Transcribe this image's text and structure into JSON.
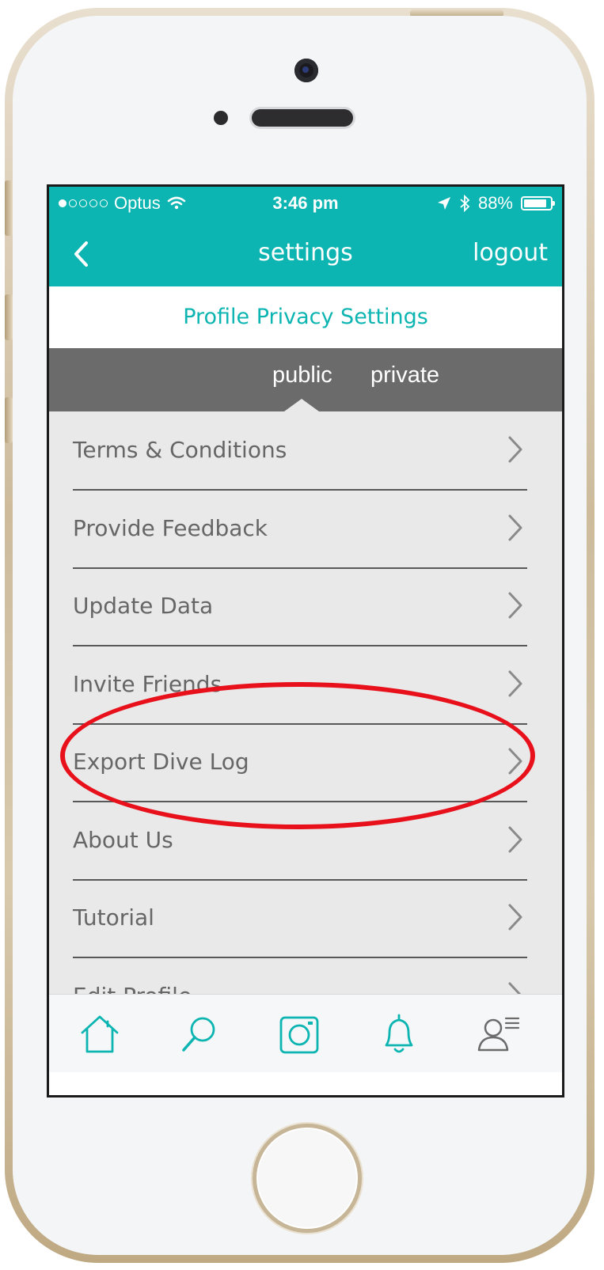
{
  "status_bar": {
    "carrier": "Optus",
    "time": "3:46 pm",
    "battery": "88%",
    "battery_level": 0.88,
    "signal_bars_filled": 1,
    "signal_bars_total": 5
  },
  "nav": {
    "back_icon": "chevron-left-icon",
    "title": "settings",
    "logout_label": "logout"
  },
  "privacy_link": "Profile Privacy Settings",
  "privacy_toggle": {
    "public_label": "public",
    "private_label": "private",
    "selected": "public"
  },
  "settings_items": [
    {
      "label": "Terms & Conditions"
    },
    {
      "label": "Provide Feedback"
    },
    {
      "label": "Update Data"
    },
    {
      "label": "Invite Friends"
    },
    {
      "label": "Export Dive Log"
    },
    {
      "label": "About Us"
    },
    {
      "label": "Tutorial"
    },
    {
      "label": "Edit Profile"
    }
  ],
  "highlighted_item": "Export Dive Log",
  "tab_bar": [
    {
      "icon": "home-icon"
    },
    {
      "icon": "search-icon"
    },
    {
      "icon": "camera-icon"
    },
    {
      "icon": "bell-icon"
    },
    {
      "icon": "profile-menu-icon"
    }
  ],
  "colors": {
    "accent": "#0cb5b1",
    "toggle_bg": "#6b6b6b",
    "list_bg": "#e9e9e9",
    "highlight": "#e8111b"
  }
}
